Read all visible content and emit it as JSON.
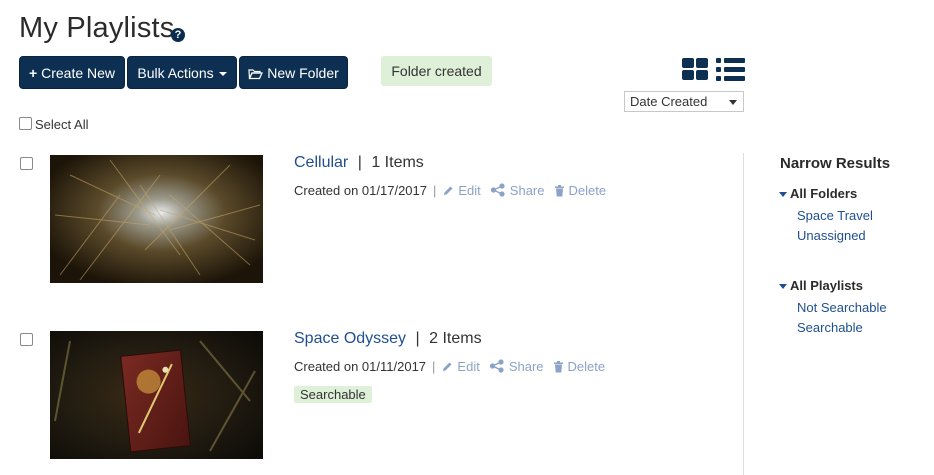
{
  "page": {
    "title": "My Playlists",
    "help_glyph": "?"
  },
  "toolbar": {
    "create_new": "Create New",
    "bulk_actions": "Bulk Actions",
    "new_folder": "New Folder"
  },
  "toast": "Folder created",
  "view_icons": [
    "grid-view-icon",
    "list-view-icon"
  ],
  "sort": {
    "selected": "Date Created"
  },
  "select_all": "Select All",
  "playlists": [
    {
      "title": "Cellular",
      "separator": "|",
      "count": "1",
      "count_label": "Items",
      "created": "Created on 01/17/2017",
      "meta_sep": "|",
      "actions": {
        "edit": "Edit",
        "share": "Share",
        "delete": "Delete"
      }
    },
    {
      "title": "Space Odyssey",
      "separator": "|",
      "count": "2",
      "count_label": "Items",
      "created": "Created on 01/11/2017",
      "meta_sep": "|",
      "actions": {
        "edit": "Edit",
        "share": "Share",
        "delete": "Delete"
      },
      "badge": "Searchable"
    }
  ],
  "sidebar": {
    "title": "Narrow Results",
    "folders": {
      "heading": "All Folders",
      "items": [
        "Space Travel",
        "Unassigned"
      ]
    },
    "playlists": {
      "heading": "All Playlists",
      "items": [
        "Not Searchable",
        "Searchable"
      ]
    }
  },
  "colors": {
    "primary": "#0c2f52",
    "link": "#1f4f8f",
    "action_muted": "#8ba3c7",
    "success_bg": "#dff0d8"
  }
}
